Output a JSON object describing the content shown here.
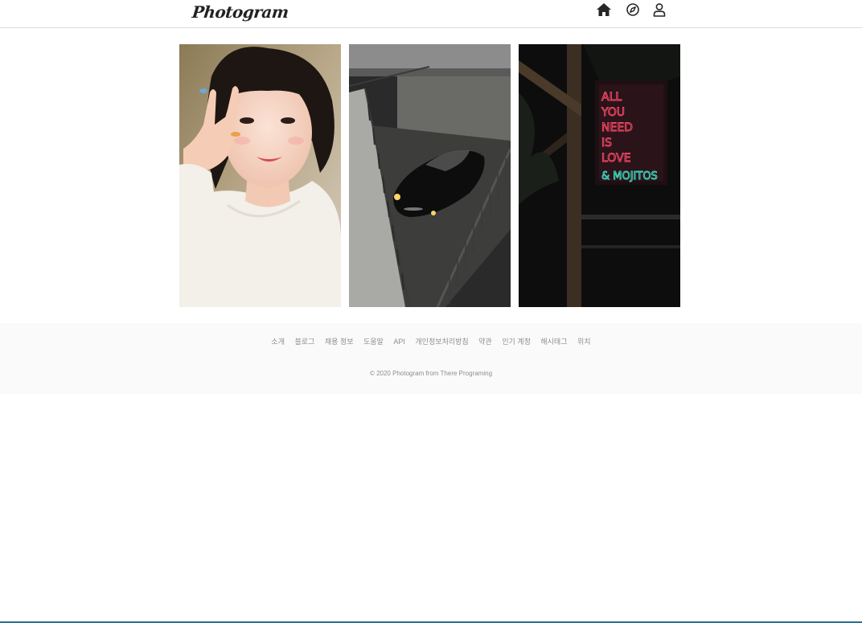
{
  "header": {
    "logo": "Photogram",
    "nav": [
      {
        "icon": "home-icon"
      },
      {
        "icon": "compass-icon"
      },
      {
        "icon": "user-icon"
      }
    ]
  },
  "gallery": {
    "photos": [
      {
        "subject": "selfie-portrait"
      },
      {
        "subject": "car-in-parking-garage"
      },
      {
        "subject": "neon-sign",
        "sign_text": [
          "ALL",
          "YOU",
          "NEED",
          "IS",
          "LOVE",
          "& MOJITOS"
        ]
      }
    ]
  },
  "footer": {
    "links": [
      "소개",
      "블로그",
      "채용 정보",
      "도움말",
      "API",
      "개인정보처리방침",
      "약관",
      "인기 계정",
      "해시태그",
      "위치"
    ],
    "copyright": "© 2020 Photogram from There Programing"
  },
  "colors": {
    "border": "#dbdbdb",
    "footer_bg": "#fafafa",
    "footer_text": "#8e8e8e",
    "neon_pink": "#ff4a6a",
    "neon_teal": "#3fe3c8"
  }
}
